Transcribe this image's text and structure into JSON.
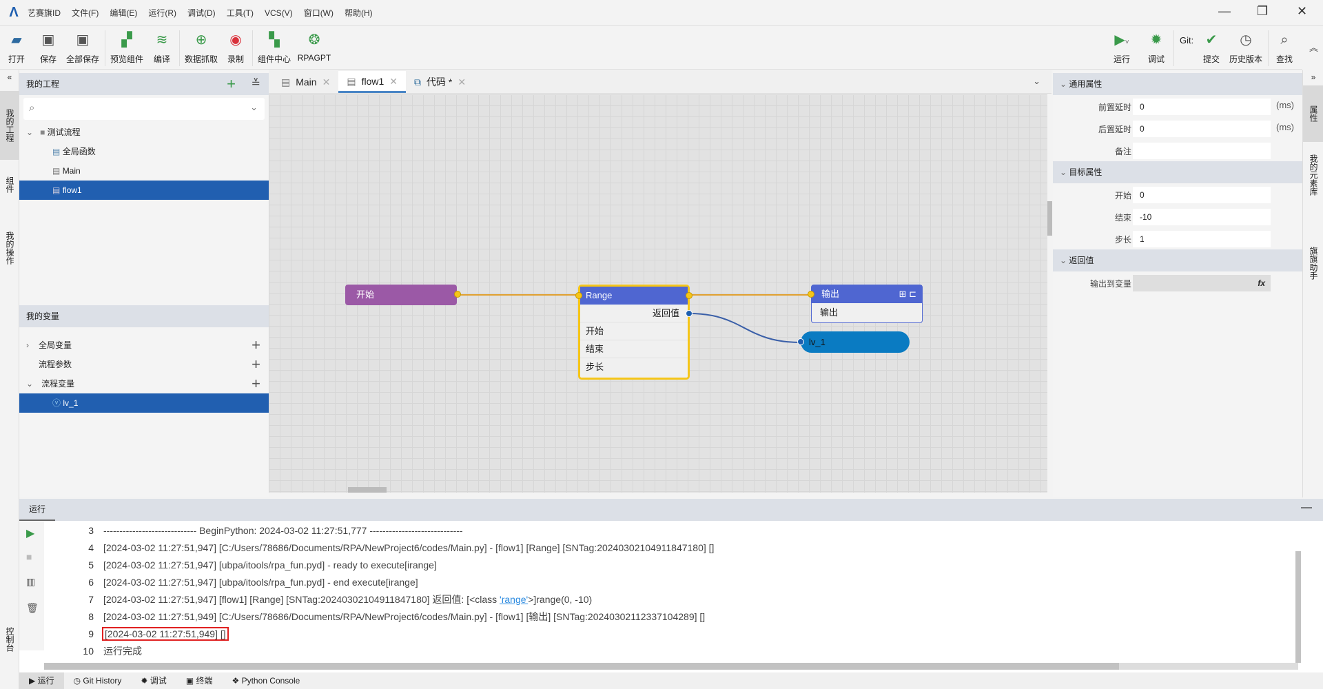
{
  "app": {
    "menu": [
      "艺赛旗ID",
      "文件(F)",
      "编辑(E)",
      "运行(R)",
      "调试(D)",
      "工具(T)",
      "VCS(V)",
      "窗口(W)",
      "帮助(H)"
    ]
  },
  "toolbar": {
    "left": [
      {
        "icon": "folder-open-icon",
        "label": "打开"
      },
      {
        "icon": "save-icon",
        "label": "保存"
      },
      {
        "icon": "save-all-icon",
        "label": "全部保存"
      },
      {
        "icon": "preview-components-icon",
        "label": "预览组件"
      },
      {
        "icon": "compile-icon",
        "label": "编译"
      },
      {
        "icon": "data-capture-icon",
        "label": "数据抓取"
      },
      {
        "icon": "record-icon",
        "label": "录制"
      },
      {
        "icon": "component-center-icon",
        "label": "组件中心"
      },
      {
        "icon": "rpagpt-icon",
        "label": "RPAGPT"
      }
    ],
    "right": {
      "run": "运行",
      "debug": "调试",
      "git": "Git:",
      "commit": "提交",
      "history": "历史版本",
      "find": "查找"
    }
  },
  "left_strip": {
    "project": "我的工程",
    "components": "组件",
    "operations": "我的操作",
    "console": "控制台"
  },
  "project": {
    "title": "我的工程",
    "search_placeholder": "",
    "tree": [
      {
        "label": "测试流程",
        "type": "folder"
      },
      {
        "label": "全局函数"
      },
      {
        "label": "Main"
      },
      {
        "label": "flow1",
        "selected": true
      }
    ]
  },
  "variables": {
    "title": "我的变量",
    "groups": [
      {
        "label": "全局变量"
      },
      {
        "label": "流程参数"
      },
      {
        "label": "流程变量"
      }
    ],
    "items": [
      {
        "label": "lv_1",
        "selected": true
      }
    ]
  },
  "tabs": [
    {
      "label": "Main"
    },
    {
      "label": "flow1",
      "active": true
    },
    {
      "label": "代码 *"
    }
  ],
  "flow": {
    "start": "开始",
    "range": {
      "title": "Range",
      "ret": "返回值",
      "params": [
        "开始",
        "结束",
        "步长"
      ]
    },
    "output": {
      "title": "输出",
      "body": "输出"
    },
    "var": "lv_1"
  },
  "properties": {
    "general": {
      "title": "通用属性",
      "pre_delay_label": "前置延时",
      "pre_delay": "0",
      "post_delay_label": "后置延时",
      "post_delay": "0",
      "unit": "(ms)",
      "note_label": "备注",
      "note": ""
    },
    "target": {
      "title": "目标属性",
      "start_label": "开始",
      "start": "0",
      "end_label": "结束",
      "end": "-10",
      "step_label": "步长",
      "step": "1"
    },
    "ret": {
      "title": "返回值",
      "out_label": "输出到变量",
      "out": "",
      "fx": "fx"
    }
  },
  "right_strip": {
    "props": "属性",
    "elements": "我的元素库",
    "assistant": "旗旗助手"
  },
  "console": {
    "title": "运行",
    "lines": [
      {
        "n": "3",
        "text": "----------------------------- BeginPython: 2024-03-02 11:27:51,777 -----------------------------"
      },
      {
        "n": "4",
        "text": "[2024-03-02 11:27:51,947] [C:/Users/78686/Documents/RPA/NewProject6/codes/Main.py] - [flow1] [Range] [SNTag:20240302104911847180] []"
      },
      {
        "n": "5",
        "text": "[2024-03-02 11:27:51,947] [ubpa/itools/rpa_fun.pyd] - ready to execute[irange]"
      },
      {
        "n": "6",
        "text": "[2024-03-02 11:27:51,947] [ubpa/itools/rpa_fun.pyd] - end execute[irange]"
      },
      {
        "n": "7",
        "text": "[2024-03-02 11:27:51,947] [flow1] [Range] [SNTag:20240302104911847180]  返回值: [<class ",
        "link": "'range'",
        "after": ">]range(0, -10)"
      },
      {
        "n": "8",
        "text": "[2024-03-02 11:27:51,949] [C:/Users/78686/Documents/RPA/NewProject6/codes/Main.py] - [flow1] [输出] [SNTag:20240302112337104289] []"
      },
      {
        "n": "9",
        "text": "[2024-03-02 11:27:51,949] []",
        "highlight": true
      },
      {
        "n": "10",
        "text": "运行完成"
      }
    ]
  },
  "bottom_tabs": [
    "运行",
    "Git History",
    "调试",
    "终端",
    "Python Console"
  ],
  "colors": {
    "selection": "#215fb0",
    "start_node": "#9b59a6",
    "node_header": "#4f66d1",
    "var_node": "#0a7bc2",
    "highlight": "#e02020"
  }
}
